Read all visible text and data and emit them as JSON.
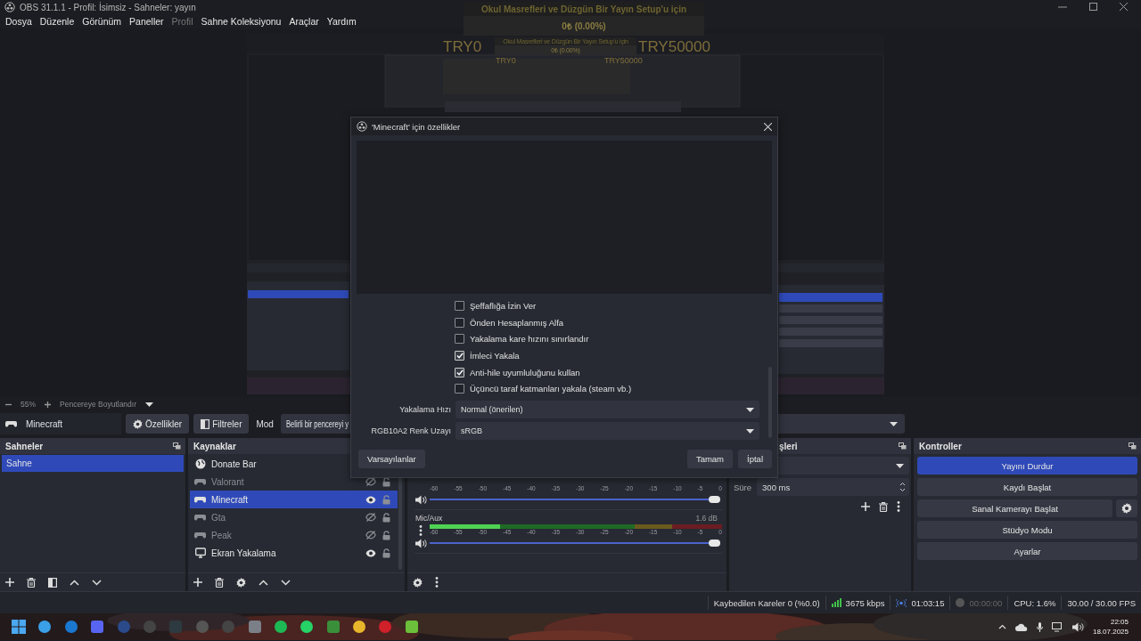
{
  "window": {
    "title": "OBS 31.1.1 - Profil: İsimsiz - Sahneler: yayın"
  },
  "menu": [
    {
      "label": "Dosya",
      "disabled": false
    },
    {
      "label": "Düzenle",
      "disabled": false
    },
    {
      "label": "Görünüm",
      "disabled": false
    },
    {
      "label": "Paneller",
      "disabled": false
    },
    {
      "label": "Profil",
      "disabled": true
    },
    {
      "label": "Sahne Koleksiyonu",
      "disabled": false
    },
    {
      "label": "Araçlar",
      "disabled": false
    },
    {
      "label": "Yardım",
      "disabled": false
    }
  ],
  "donate_widgets": [
    {
      "title": "Okul Masrefleri ve Düzgün Bir Yayın Setup'u için",
      "amount": "0₺ (0.00%)",
      "min": "TRY0",
      "max": "TRY50000"
    },
    {
      "title": "Okul Masrefleri ve Düzgün Bir Yayın Setup'u için",
      "amount": "0₺ (0.00%)",
      "min": "TRY0",
      "max": "TRY50000"
    }
  ],
  "zoom_bar": {
    "zoom": "55%",
    "fit": "Pencereye Boyutlandır"
  },
  "source_toolbar": {
    "source": "Minecraft",
    "properties": "Özellikler",
    "filters": "Filtreler",
    "mode_label": "Mod",
    "mode_value": "Belirli bir pencereyi y"
  },
  "scenes": {
    "title": "Sahneler",
    "items": [
      {
        "label": "Sahne",
        "selected": true
      }
    ]
  },
  "sources": {
    "title": "Kaynaklar",
    "items": [
      {
        "label": "Donate Bar",
        "kind": "browser",
        "visible": true,
        "selected": false
      },
      {
        "label": "Valorant",
        "kind": "game",
        "visible": false,
        "selected": false
      },
      {
        "label": "Minecraft",
        "kind": "game",
        "visible": true,
        "selected": true
      },
      {
        "label": "Gta",
        "kind": "game",
        "visible": false,
        "selected": false
      },
      {
        "label": "Peak",
        "kind": "game",
        "visible": false,
        "selected": false
      },
      {
        "label": "Ekran Yakalama",
        "kind": "display",
        "visible": true,
        "selected": false
      }
    ]
  },
  "mixer": {
    "tracks": [
      {
        "ticks": [
          "-60",
          "-55",
          "-50",
          "-45",
          "-40",
          "-35",
          "-30",
          "-25",
          "-20",
          "-15",
          "-10",
          "-5",
          "0"
        ],
        "volume": {
          "level": 1.0
        }
      },
      {
        "name": "Mic/Aux",
        "reading": "1.6 dB",
        "meter": {
          "level": 0.24
        },
        "ticks": [
          "-60",
          "-55",
          "-50",
          "-45",
          "-40",
          "-35",
          "-30",
          "-25",
          "-20",
          "-15",
          "-10",
          "-5",
          "0"
        ],
        "volume": {
          "level": 1.0
        }
      }
    ]
  },
  "transitions": {
    "title": "şleri",
    "duration_label": "Süre",
    "duration": "300 ms"
  },
  "controls": {
    "title": "Kontroller",
    "buttons": [
      {
        "label": "Yayını Durdur",
        "active": true,
        "has_settings": false
      },
      {
        "label": "Kaydı Başlat",
        "active": false,
        "has_settings": false
      },
      {
        "label": "Sanal Kamerayı Başlat",
        "active": false,
        "has_settings": true
      },
      {
        "label": "Stüdyo Modu",
        "active": false,
        "has_settings": false
      },
      {
        "label": "Ayarlar",
        "active": false,
        "has_settings": false
      }
    ]
  },
  "status_bar": {
    "dropped": "Kaybedilen Kareler 0 (%0.0)",
    "bitrate": "3675 kbps",
    "streaming": true,
    "stream_time": "01:03:15",
    "recording": false,
    "record_time": "00:00:00",
    "cpu": "CPU: 1.6%",
    "fps": "30.00 / 30.00 FPS"
  },
  "dialog": {
    "title": "'Minecraft' için özellikler",
    "options": [
      {
        "label": "Şeffaflığa İzin Ver",
        "checked": false
      },
      {
        "label": "Önden Hesaplanmış Alfa",
        "checked": false
      },
      {
        "label": "Yakalama kare hızını sınırlandır",
        "checked": false
      },
      {
        "label": "İmleci Yakala",
        "checked": true
      },
      {
        "label": "Anti-hile uyumluluğunu kullan",
        "checked": true
      },
      {
        "label": "Üçüncü taraf katmanları yakala (steam vb.)",
        "checked": false
      }
    ],
    "fields": [
      {
        "label": "Yakalama Hızı",
        "value": "Normal (önerilen)"
      },
      {
        "label": "RGB10A2 Renk Uzayı",
        "value": "sRGB"
      }
    ],
    "defaults_button": "Varsayılanlar",
    "ok_button": "Tamam",
    "cancel_button": "İptal"
  },
  "taskbar": {
    "time": "22:05",
    "date": "18.07.2025"
  }
}
